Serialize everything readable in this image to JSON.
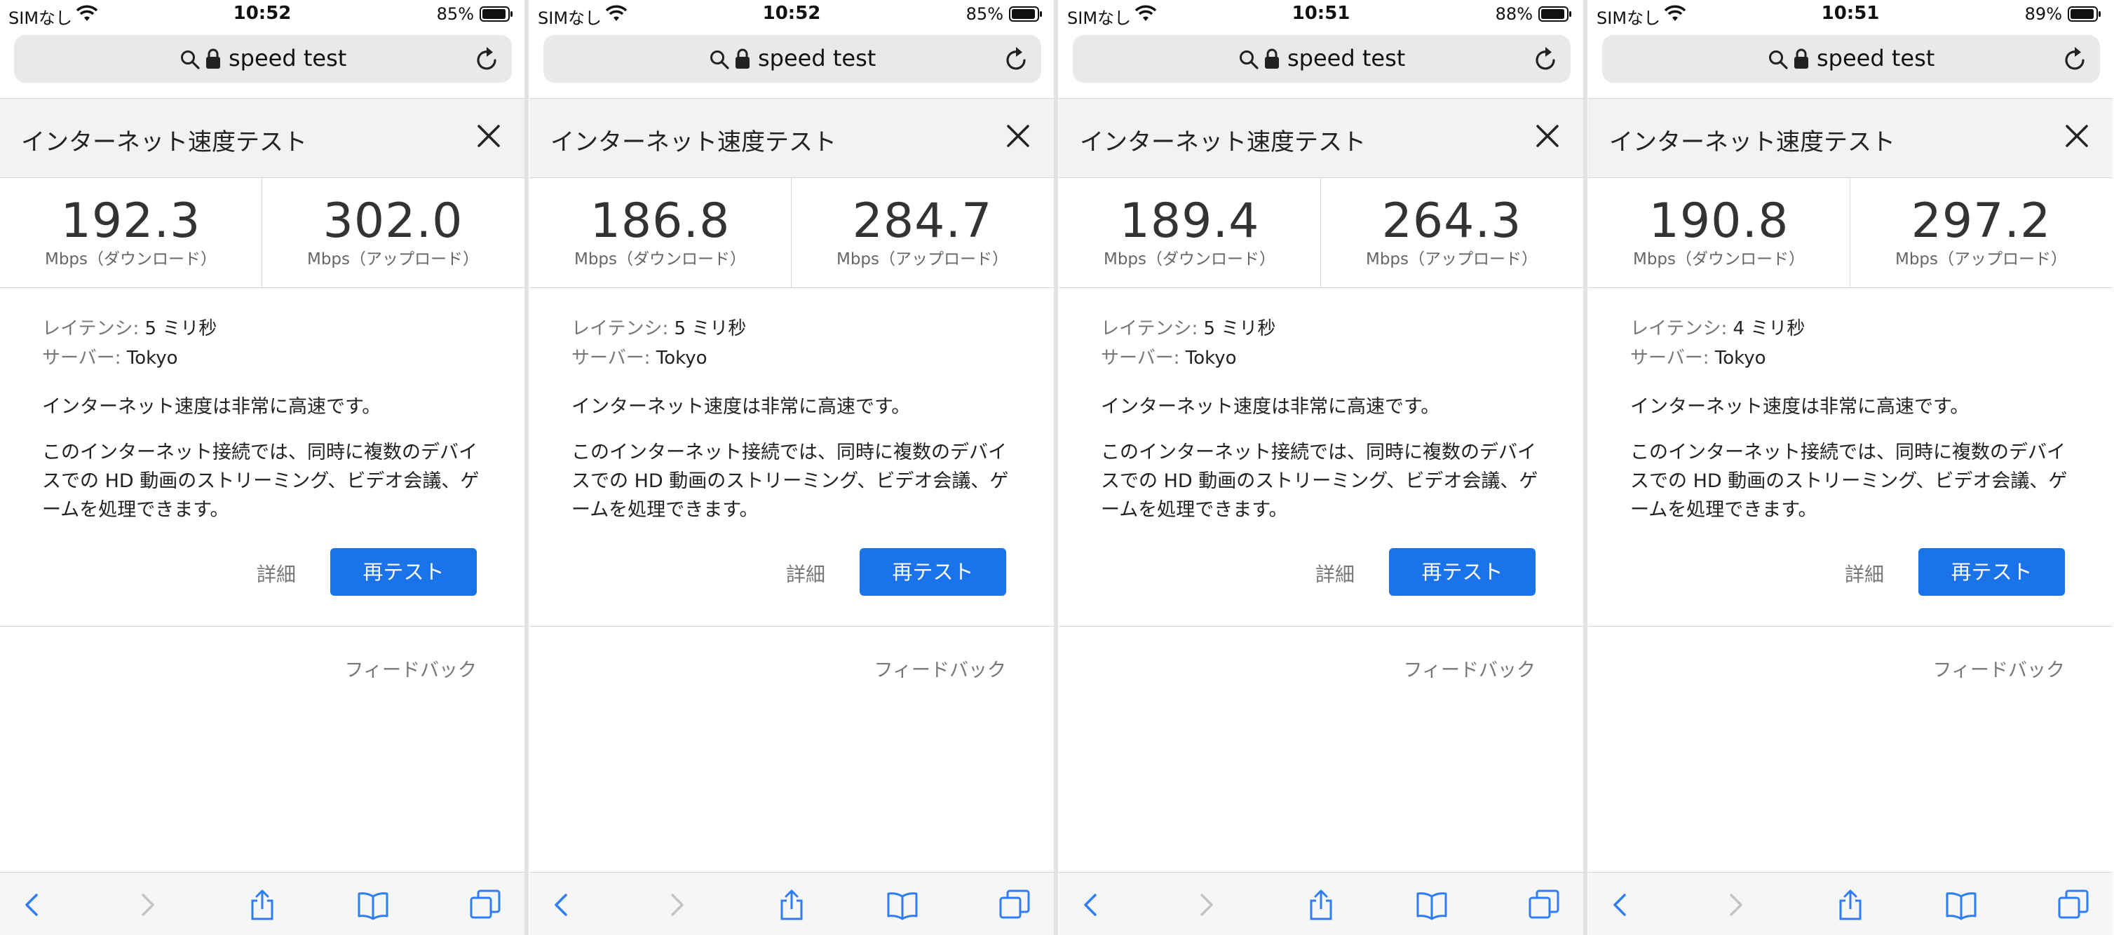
{
  "accent_color": "#1a73e8",
  "icon_color": "#2f7df6",
  "screens": [
    {
      "status": {
        "carrier": "SIMなし",
        "time": "10:52",
        "battery": "85%"
      },
      "url": "speed test",
      "widget_title": "インターネット速度テスト",
      "download": {
        "value": "192.3",
        "unit": "Mbps（ダウンロード）"
      },
      "upload": {
        "value": "302.0",
        "unit": "Mbps（アップロード）"
      },
      "latency_label": "レイテンシ:",
      "latency_value": "5 ミリ秒",
      "server_label": "サーバー:",
      "server_value": "Tokyo",
      "summary": "インターネット速度は非常に高速です。",
      "description": "このインターネット接続では、同時に複数のデバイスでの HD 動画のストリーミング、ビデオ会議、ゲームを処理できます。",
      "details_label": "詳細",
      "retest_label": "再テスト",
      "feedback_label": "フィードバック"
    },
    {
      "status": {
        "carrier": "SIMなし",
        "time": "10:52",
        "battery": "85%"
      },
      "url": "speed test",
      "widget_title": "インターネット速度テスト",
      "download": {
        "value": "186.8",
        "unit": "Mbps（ダウンロード）"
      },
      "upload": {
        "value": "284.7",
        "unit": "Mbps（アップロード）"
      },
      "latency_label": "レイテンシ:",
      "latency_value": "5 ミリ秒",
      "server_label": "サーバー:",
      "server_value": "Tokyo",
      "summary": "インターネット速度は非常に高速です。",
      "description": "このインターネット接続では、同時に複数のデバイスでの HD 動画のストリーミング、ビデオ会議、ゲームを処理できます。",
      "details_label": "詳細",
      "retest_label": "再テスト",
      "feedback_label": "フィードバック"
    },
    {
      "status": {
        "carrier": "SIMなし",
        "time": "10:51",
        "battery": "88%"
      },
      "url": "speed test",
      "widget_title": "インターネット速度テスト",
      "download": {
        "value": "189.4",
        "unit": "Mbps（ダウンロード）"
      },
      "upload": {
        "value": "264.3",
        "unit": "Mbps（アップロード）"
      },
      "latency_label": "レイテンシ:",
      "latency_value": "5 ミリ秒",
      "server_label": "サーバー:",
      "server_value": "Tokyo",
      "summary": "インターネット速度は非常に高速です。",
      "description": "このインターネット接続では、同時に複数のデバイスでの HD 動画のストリーミング、ビデオ会議、ゲームを処理できます。",
      "details_label": "詳細",
      "retest_label": "再テスト",
      "feedback_label": "フィードバック"
    },
    {
      "status": {
        "carrier": "SIMなし",
        "time": "10:51",
        "battery": "89%"
      },
      "url": "speed test",
      "widget_title": "インターネット速度テスト",
      "download": {
        "value": "190.8",
        "unit": "Mbps（ダウンロード）"
      },
      "upload": {
        "value": "297.2",
        "unit": "Mbps（アップロード）"
      },
      "latency_label": "レイテンシ:",
      "latency_value": "4 ミリ秒",
      "server_label": "サーバー:",
      "server_value": "Tokyo",
      "summary": "インターネット速度は非常に高速です。",
      "description": "このインターネット接続では、同時に複数のデバイスでの HD 動画のストリーミング、ビデオ会議、ゲームを処理できます。",
      "details_label": "詳細",
      "retest_label": "再テスト",
      "feedback_label": "フィードバック"
    }
  ]
}
